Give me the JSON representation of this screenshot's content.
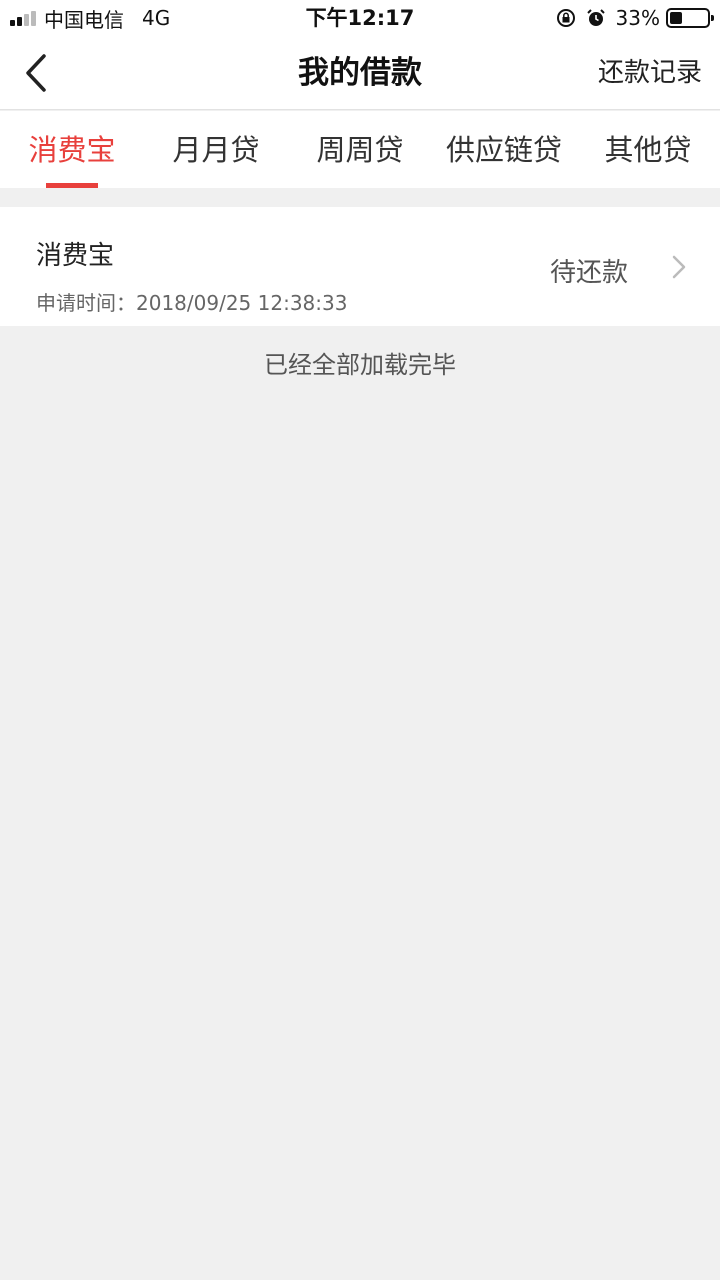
{
  "status_bar": {
    "carrier": "中国电信",
    "network": "4G",
    "time": "下午12:17",
    "battery": "33%",
    "battery_level": 0.33
  },
  "nav": {
    "title": "我的借款",
    "action_label": "还款记录"
  },
  "tabs": [
    {
      "label": "消费宝",
      "active": true
    },
    {
      "label": "月月贷",
      "active": false
    },
    {
      "label": "周周贷",
      "active": false
    },
    {
      "label": "供应链贷",
      "active": false
    },
    {
      "label": "其他贷",
      "active": false
    }
  ],
  "loans": [
    {
      "name": "消费宝",
      "time_label": "申请时间：",
      "time": "2018/09/25 12:38:33",
      "status": "待还款"
    }
  ],
  "footer_note": "已经全部加载完毕",
  "colors": {
    "accent": "#e8403c",
    "background": "#f0f0f0"
  }
}
